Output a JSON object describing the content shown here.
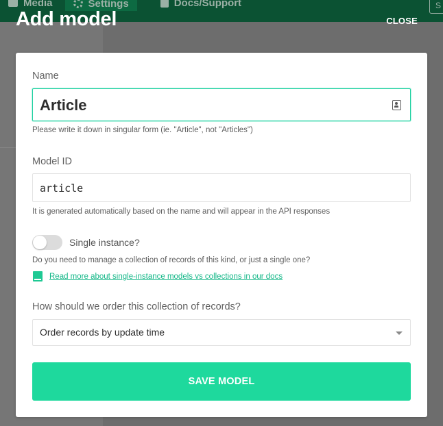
{
  "background": {
    "nav_items": [
      {
        "label": "Media",
        "icon": "image-icon"
      },
      {
        "label": "Settings",
        "icon": "gear-icon"
      },
      {
        "label": "Docs/Support",
        "icon": "book-icon"
      }
    ],
    "corner_button_label": "S"
  },
  "modal": {
    "title": "Add model",
    "close_label": "CLOSE",
    "name": {
      "label": "Name",
      "value": "Article",
      "hint": "Please write it down in singular form (ie. \"Article\", not \"Articles\")",
      "icon": "contact-card-icon"
    },
    "model_id": {
      "label": "Model ID",
      "value": "article",
      "hint": "It is generated automatically based on the name and will appear in the API responses"
    },
    "single_instance": {
      "label": "Single instance?",
      "enabled": false,
      "hint": "Do you need to manage a collection of records of this kind, or just a single one?",
      "link_text": "Read more about single-instance models vs collections in our docs",
      "link_icon": "book-icon"
    },
    "ordering": {
      "label": "How should we order this collection of records?",
      "selected": "Order records by update time"
    },
    "save_label": "SAVE MODEL"
  },
  "colors": {
    "accent": "#1ed99d",
    "link": "#12b787",
    "focus_border": "#1fd1a1",
    "topbar": "#0b5233"
  }
}
